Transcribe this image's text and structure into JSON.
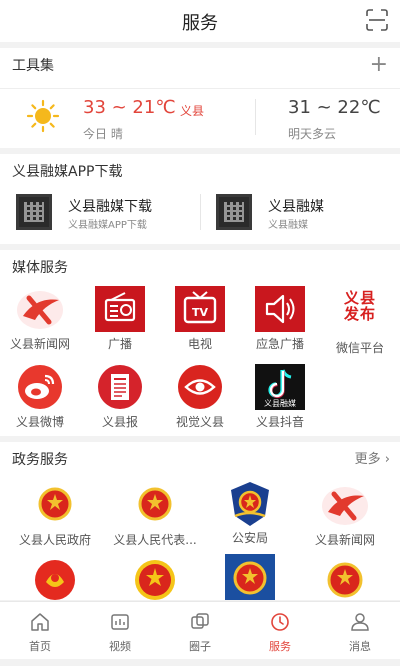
{
  "header": {
    "title": "服务",
    "scan_icon": "scan-icon"
  },
  "tools": {
    "title": "工具集",
    "add_icon": "plus-icon",
    "weather": {
      "today_temp": "33 ~ 21℃",
      "county": "义县",
      "today_label": "今日 晴",
      "tomorrow_temp": "31 ~ 22℃",
      "tomorrow_label": "明天多云",
      "icon": "sun-icon"
    }
  },
  "apps": {
    "title": "义县融媒APP下载",
    "items": [
      {
        "name": "义县融媒下载",
        "sub": "义县融媒APP下载"
      },
      {
        "name": "义县融媒",
        "sub": "义县融媒"
      }
    ]
  },
  "media": {
    "title": "媒体服务",
    "items": [
      {
        "label": "义县新闻网",
        "icon": "yixian-news-logo-icon"
      },
      {
        "label": "广播",
        "icon": "radio-icon"
      },
      {
        "label": "电视",
        "icon": "tv-icon"
      },
      {
        "label": "应急广播",
        "icon": "speaker-icon"
      },
      {
        "label": "微信平台",
        "icon": "yixian-fabu-logo-icon",
        "logo_text": "义县发布"
      },
      {
        "label": "义县微博",
        "icon": "weibo-icon"
      },
      {
        "label": "义县报",
        "icon": "newspaper-icon"
      },
      {
        "label": "视觉义县",
        "icon": "eye-icon"
      },
      {
        "label": "义县抖音",
        "icon": "douyin-icon",
        "logo_text": "义县融媒"
      }
    ]
  },
  "gov": {
    "title": "政务服务",
    "more": "更多",
    "items": [
      {
        "label": "义县人民政府",
        "icon": "national-emblem-icon"
      },
      {
        "label": "义县人民代表...",
        "icon": "national-emblem-icon"
      },
      {
        "label": "公安局",
        "icon": "police-badge-icon"
      },
      {
        "label": "义县新闻网",
        "icon": "yixian-news-logo-icon"
      },
      {
        "label": "",
        "icon": "womens-federation-icon"
      },
      {
        "label": "",
        "icon": "youth-league-icon"
      },
      {
        "label": "",
        "icon": "national-emblem-icon"
      },
      {
        "label": "",
        "icon": "national-emblem-icon"
      }
    ]
  },
  "tabbar": {
    "items": [
      {
        "label": "首页",
        "icon": "home-icon"
      },
      {
        "label": "视频",
        "icon": "video-icon"
      },
      {
        "label": "圈子",
        "icon": "circle-icon"
      },
      {
        "label": "服务",
        "icon": "service-icon",
        "active": true
      },
      {
        "label": "消息",
        "icon": "message-icon"
      }
    ]
  },
  "colors": {
    "accent": "#e2453b",
    "brand_red": "#c9171e",
    "gold": "#f2c12e"
  }
}
